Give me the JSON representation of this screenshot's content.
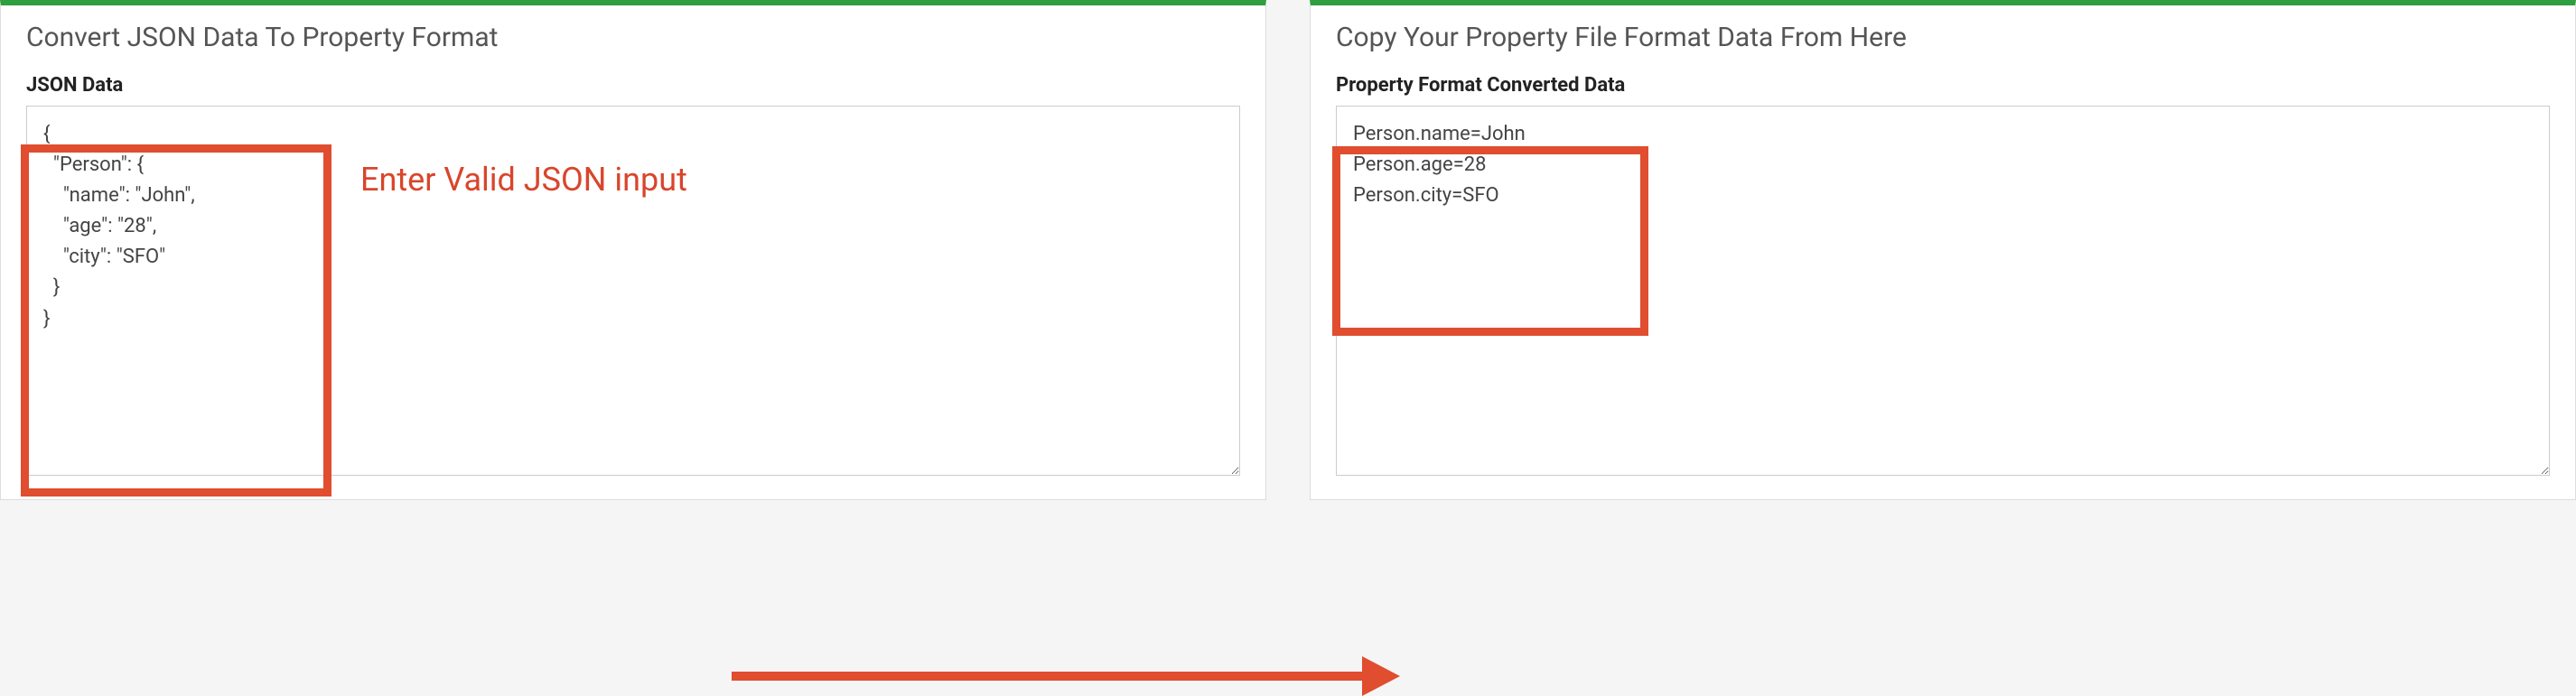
{
  "leftPanel": {
    "title": "Convert JSON Data To Property Format",
    "fieldLabel": "JSON Data",
    "textareaValue": "{\n  \"Person\": {\n    \"name\": \"John\",\n    \"age\": \"28\",\n    \"city\": \"SFO\"\n  }\n}"
  },
  "rightPanel": {
    "title": "Copy Your Property File Format Data From Here",
    "fieldLabel": "Property Format Converted Data",
    "textareaValue": "Person.name=John\nPerson.age=28\nPerson.city=SFO"
  },
  "annotation": {
    "text": "Enter Valid JSON input"
  },
  "colors": {
    "accent": "#2e9e3f",
    "annotation": "#e04d2f"
  }
}
